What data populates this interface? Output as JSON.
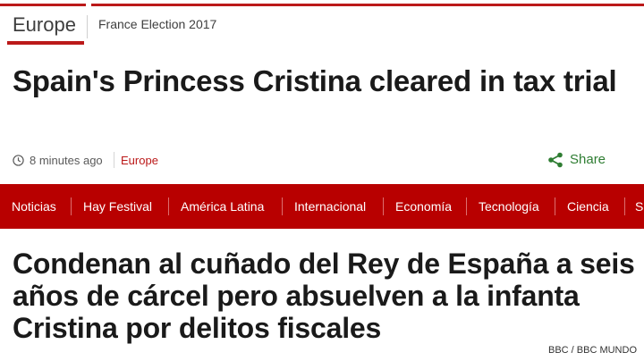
{
  "bbc_news": {
    "section_nav": {
      "active": "Europe",
      "secondary": "France Election 2017"
    },
    "headline": "Spain's Princess Cristina cleared in tax trial",
    "meta": {
      "time": "8 minutes ago",
      "category": "Europe",
      "share_label": "Share",
      "clock_icon": "clock-icon",
      "share_icon": "share-icon"
    },
    "colors": {
      "accent": "#bb1919",
      "share": "#2e7d32"
    }
  },
  "bbc_mundo": {
    "nav_items": [
      "Noticias",
      "Hay Festival",
      "América Latina",
      "Internacional",
      "Economía",
      "Tecnología",
      "Ciencia",
      "S"
    ],
    "headline": "Condenan al cuñado del Rey de España a seis años de cárcel pero absuelven a la infanta Cristina por delitos fiscales",
    "colors": {
      "nav_background": "#b80000"
    }
  },
  "credit": "BBC / BBC MUNDO"
}
